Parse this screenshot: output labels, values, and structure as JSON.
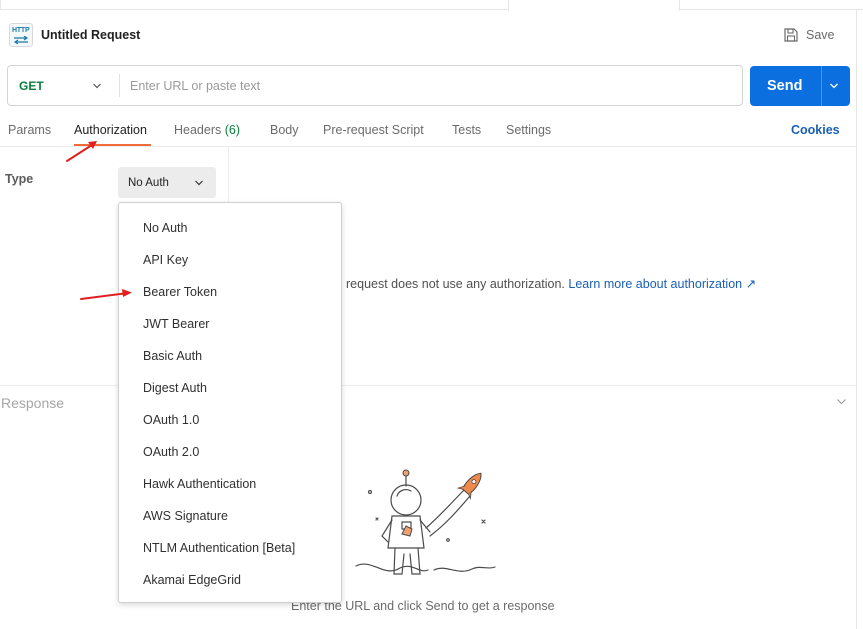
{
  "request": {
    "title": "Untitled Request",
    "icon": "http-icon",
    "icon_text": "HTTP",
    "save_label": "Save"
  },
  "url_bar": {
    "method": "GET",
    "placeholder": "Enter URL or paste text",
    "send_label": "Send"
  },
  "tabs": [
    {
      "label": "Params"
    },
    {
      "label": "Authorization",
      "active": true
    },
    {
      "label": "Headers",
      "count": "(6)"
    },
    {
      "label": "Body"
    },
    {
      "label": "Pre-request Script"
    },
    {
      "label": "Tests"
    },
    {
      "label": "Settings"
    }
  ],
  "cookies_label": "Cookies",
  "auth": {
    "type_label": "Type",
    "selected": "No Auth",
    "message_visible": "request does not use any authorization.",
    "learn_more": "Learn more about authorization ↗"
  },
  "dropdown": {
    "options": [
      "No Auth",
      "API Key",
      "Bearer Token",
      "JWT Bearer",
      "Basic Auth",
      "Digest Auth",
      "OAuth 1.0",
      "OAuth 2.0",
      "Hawk Authentication",
      "AWS Signature",
      "NTLM Authentication [Beta]",
      "Akamai EdgeGrid"
    ]
  },
  "response": {
    "label": "Response",
    "empty_message": "Enter the URL and click Send to get a response"
  },
  "colors": {
    "accent_send": "#0c6fe0",
    "method_get": "#0a7f3f",
    "tab_underline": "#f26b3a",
    "link": "#1a5fb4",
    "annotation": "#e02020"
  }
}
